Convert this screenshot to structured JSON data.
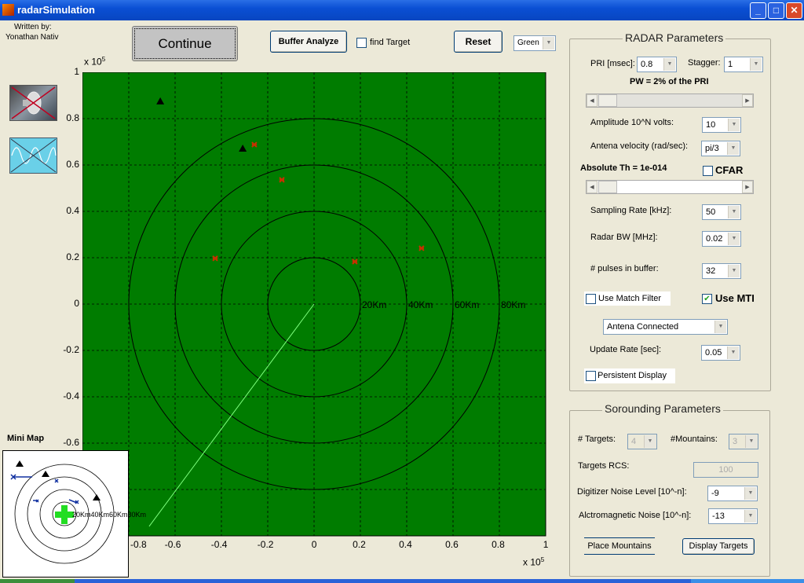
{
  "window": {
    "title": "radarSimulation",
    "minimize": "_",
    "maximize": "□",
    "close": "✕"
  },
  "credits": {
    "line1": "Written by:",
    "line2": "Yonathan Nativ"
  },
  "toolbar": {
    "continue": "Continue",
    "buffer_analyze": "Buffer Analyze",
    "find_target": "find Target",
    "find_target_checked": false,
    "reset": "Reset",
    "color_select": "Green"
  },
  "icons": {
    "antenna": "antenna-dish-disabled-icon",
    "scope": "oscilloscope-disabled-icon"
  },
  "plot": {
    "background": "#007c00",
    "x_exponent_label": "x 10",
    "x_exponent": "5",
    "y_exponent_label": "x 10",
    "y_exponent": "5",
    "xlim": [
      -1,
      1
    ],
    "ylim": [
      -1,
      1
    ],
    "x_ticks": [
      "-0.8",
      "-0.6",
      "-0.4",
      "-0.2",
      "0",
      "0.2",
      "0.4",
      "0.6",
      "0.8",
      "1"
    ],
    "x_tick_values": [
      -0.8,
      -0.6,
      -0.4,
      -0.2,
      0,
      0.2,
      0.4,
      0.6,
      0.8,
      1
    ],
    "y_ticks": [
      "1",
      "0.8",
      "0.6",
      "0.4",
      "0.2",
      "0",
      "-0.2",
      "-0.4",
      "-0.6"
    ],
    "y_tick_values": [
      1,
      0.8,
      0.6,
      0.4,
      0.2,
      0,
      -0.2,
      -0.4,
      -0.6
    ],
    "grid": true,
    "range_rings": [
      0.2,
      0.4,
      0.6,
      0.8
    ],
    "range_labels": [
      "20Km",
      "40Km",
      "60Km",
      "80Km"
    ],
    "targets": [
      [
        -0.258,
        0.688
      ],
      [
        -0.139,
        0.536
      ],
      [
        -0.427,
        0.197
      ],
      [
        0.176,
        0.183
      ],
      [
        0.464,
        0.241
      ]
    ],
    "target_color": "#c83000",
    "mountains": [
      [
        -0.664,
        0.875
      ],
      [
        -0.308,
        0.671
      ]
    ],
    "sweep_end": [
      -0.712,
      -0.959
    ],
    "sweep_color": "#7dff7d"
  },
  "minimap": {
    "title": "Mini Map",
    "labels": "20Km40Km60Km80Km"
  },
  "radar": {
    "title": "RADAR Parameters",
    "pri_label": "PRI [msec]:",
    "pri": "0.8",
    "stagger_label": "Stagger:",
    "stagger": "1",
    "pw_label": "PW = 2% of the PRI",
    "pw_slider": 0.02,
    "amplitude_label": "Amplitude 10^N volts:",
    "amplitude": "10",
    "antena_vel_label": "Antena velocity (rad/sec):",
    "antena_vel": "pi/3",
    "threshold_label": "Absolute Th = 1e-014",
    "threshold_slider": 0.02,
    "cfar_label": "CFAR",
    "cfar_checked": false,
    "sampling_label": "Sampling Rate [kHz]:",
    "sampling": "50",
    "bw_label": "Radar BW [MHz]:",
    "bw": "0.02",
    "pulses_label": "# pulses in buffer:",
    "pulses": "32",
    "match_filter_label": "Use Match Filter",
    "match_filter_checked": false,
    "mti_label": "Use MTI",
    "mti_checked": true,
    "check_mark": "✔",
    "antena_mode": "Antena Connected",
    "update_label": "Update Rate [sec]:",
    "update": "0.05",
    "persistent_label": "Persistent Display",
    "persistent_checked": false
  },
  "surrounding": {
    "title": "Sorounding Parameters",
    "targets_label": "# Targets:",
    "targets": "4",
    "mountains_label": "#Mountains:",
    "mountains": "3",
    "rcs_label": "Targets RCS:",
    "rcs": "100",
    "digitizer_label": "Digitizer Noise Level [10^-n]:",
    "digitizer": "-9",
    "em_label": "Alctromagnetic Noise [10^-n]:",
    "em": "-13",
    "place_mountains": "Place Mountains",
    "display_targets": "Display Targets"
  }
}
